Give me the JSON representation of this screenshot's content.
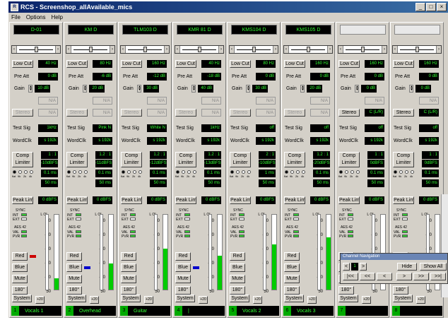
{
  "window": {
    "title": "RCS - Screenshop_allAvailable_mics",
    "icon": "rcs-app-icon"
  },
  "window_buttons": [
    "_",
    "□",
    "×"
  ],
  "menu": [
    "File",
    "Options",
    "Help"
  ],
  "strips": [
    {
      "name": "D-01",
      "lowcut": "40 Hz",
      "preatt": "0 dB",
      "gain": "10 dB",
      "na": "N/A",
      "stereo": "N/A",
      "stereo_active": false,
      "testsig": "1kHz",
      "wordclk": "s 192k",
      "ratio": "1 : 1",
      "thresh": "-10dBFS",
      "attack": "0.1 ms",
      "release": "50 ms",
      "peaklim": "0 dBFS",
      "meter": 0.15,
      "color": "Red",
      "footnum": "1",
      "footname": "Vocals 1"
    },
    {
      "name": "KM D",
      "lowcut": "80 Hz",
      "preatt": "-6 dB",
      "gain": "20 dB",
      "na": "N/A",
      "stereo": "N/A",
      "stereo_active": false,
      "testsig": "Pink N",
      "wordclk": "s 192k",
      "ratio": "1.2 : 1",
      "thresh": "-11dBFS",
      "attack": "0.1 ms",
      "release": "50 ms",
      "peaklim": "0 dBFS",
      "meter": 0.35,
      "color": "Blue",
      "footnum": "2",
      "footname": "Overhead"
    },
    {
      "name": "TLM103 D",
      "lowcut": "160 Hz",
      "preatt": "-12 dB",
      "gain": "30 dB",
      "na": "N/A",
      "stereo": "N/A",
      "stereo_active": false,
      "testsig": "White N",
      "wordclk": "s 192k",
      "ratio": "1.2 : 1",
      "thresh": "-12dBFS",
      "attack": "0.1 ms",
      "release": "50 ms",
      "peaklim": "0 dBFS",
      "meter": 0.55,
      "color": "",
      "footnum": "3",
      "footname": "Guitar"
    },
    {
      "name": "KMR 81 D",
      "lowcut": "40 Hz",
      "preatt": "-18 dB",
      "gain": "40 dB",
      "na": "N/A",
      "stereo": "N/A",
      "stereo_active": false,
      "testsig": "1kHz",
      "wordclk": "s 192k",
      "ratio": "1.2 : 1",
      "thresh": "-13dBFS",
      "attack": "0.1 ms",
      "release": "50 ms",
      "peaklim": "0 dBFS",
      "meter": 0.45,
      "color": "Blue",
      "footnum": "4",
      "footname": "|"
    },
    {
      "name": "KMS104 D",
      "lowcut": "80 Hz",
      "preatt": "0 dB",
      "gain": "30 dB",
      "na": "N/A",
      "stereo": "N/A",
      "stereo_active": false,
      "testsig": "off",
      "wordclk": "s 192k",
      "ratio": "2 : 1",
      "thresh": "-10dBFS",
      "attack": "1 ms",
      "release": "50 ms",
      "peaklim": "0 dBFS",
      "meter": 0.6,
      "color": "",
      "footnum": "5",
      "footname": "Vocals 2"
    },
    {
      "name": "KMS105 D",
      "lowcut": "160 Hz",
      "preatt": "0 dB",
      "gain": "20 dB",
      "na": "N/A",
      "stereo": "N/A",
      "stereo_active": false,
      "testsig": "off",
      "wordclk": "s 192k",
      "ratio": "1.2 : 1",
      "thresh": "-20dBFS",
      "attack": "0.1 ms",
      "release": "50 ms",
      "peaklim": "0 dBFS",
      "meter": 0.7,
      "color": "",
      "footnum": "6",
      "footname": "Vocals 3"
    },
    {
      "name": "",
      "lowcut": "160 Hz",
      "preatt": "0 dB",
      "gain": "0 dB",
      "na": "N/A",
      "stereo": "C (L/R)",
      "stereo_active": true,
      "testsig": "off",
      "wordclk": "s 192k",
      "ratio": "1 : 1",
      "thresh": "0dBFS",
      "attack": "0.1 ms",
      "release": "50 ms",
      "peaklim": "0 dBFS",
      "meter": 0.0,
      "color": "",
      "footnum": "7",
      "footname": ""
    },
    {
      "name": "",
      "lowcut": "160 Hz",
      "preatt": "0 dB",
      "gain": "0 dB",
      "na": "N/A",
      "stereo": "C (L/R)",
      "stereo_active": true,
      "testsig": "off",
      "wordclk": "s 192k",
      "ratio": "1 : 1",
      "thresh": "0dBFS",
      "attack": "0.1 ms",
      "release": "50 ms",
      "peaklim": "0 dBFS",
      "meter": 0.0,
      "color": "",
      "footnum": "8",
      "footname": ""
    }
  ],
  "labels": {
    "lowcut": "Low Cut",
    "preatt": "Pre Att",
    "gain": "Gain",
    "stereo": "Stereo",
    "testsig": "Test Sig",
    "wordclk": "WordClk",
    "comp": "Comp Limiter",
    "peaklim": "Peak Lim",
    "sync": "SYNC",
    "int": "INT",
    "ext": "EXT",
    "aes": "AES 42",
    "val": "VAL",
    "pvr": "PVR",
    "red": "Red",
    "blue": "Blue",
    "mute": "Mute",
    "phase": "180°",
    "system": "System",
    "plus20": "+20",
    "radio_labels": [
      "flat",
      "9k",
      "2k",
      "4k"
    ],
    "scale": [
      "0",
      "-10",
      "-20",
      "-30",
      "-40",
      "50"
    ],
    "lr": "L  OL"
  },
  "navpanel": {
    "title": "Channel Navigation",
    "page": "1",
    "hide": "Hide",
    "showall": "Show All",
    "prev_page": "<",
    "next_page": ">",
    "first": "|<<",
    "back2": "<<",
    "back": "<",
    "fwd": ">",
    "fwd2": ">>",
    "last": ">>|"
  }
}
